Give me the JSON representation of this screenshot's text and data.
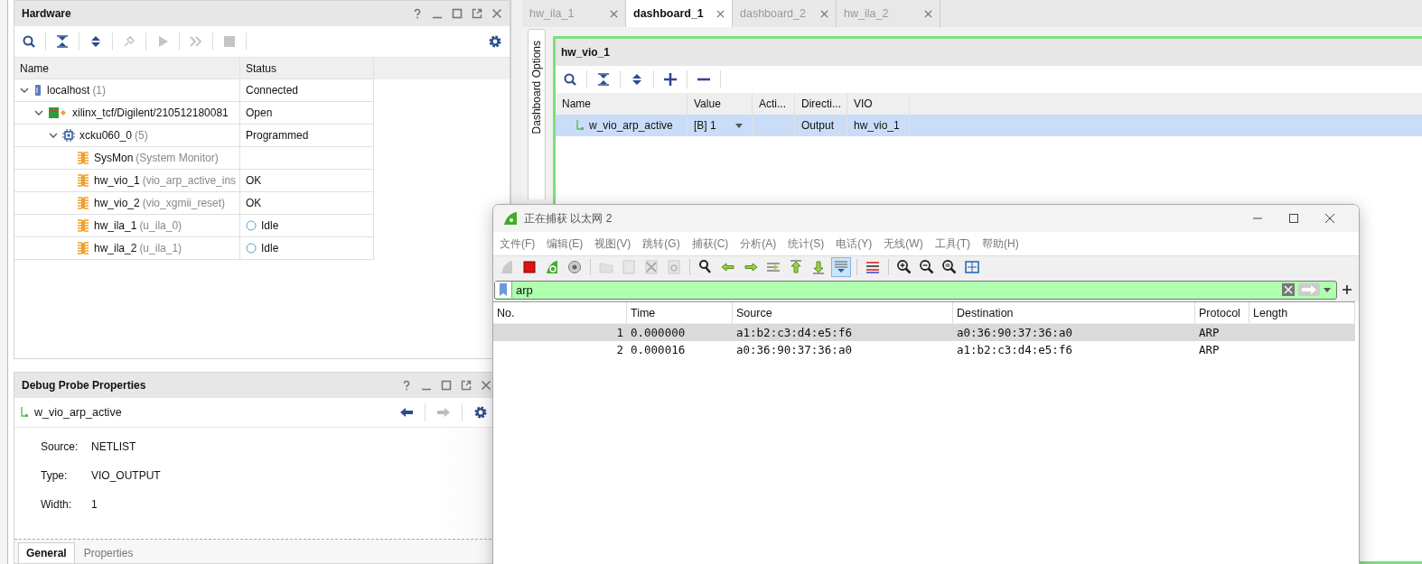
{
  "hardware": {
    "title": "Hardware",
    "toolbar": [
      {
        "kind": "search",
        "disabled": false
      },
      {
        "kind": "collapse",
        "disabled": false
      },
      {
        "kind": "expand",
        "disabled": false
      },
      {
        "kind": "connect",
        "disabled": true
      },
      {
        "kind": "run",
        "disabled": true
      },
      {
        "kind": "run-all",
        "disabled": true
      },
      {
        "kind": "stop",
        "disabled": true
      }
    ],
    "columns": [
      "Name",
      "Status"
    ],
    "tree": [
      {
        "kind": "host",
        "name": "localhost",
        "detail": "(1)",
        "status": "Connected",
        "idle": false,
        "expanded": true,
        "children": [
          {
            "kind": "target",
            "name": "xilinx_tcf/Digilent/210512180081",
            "status": "Open",
            "idle": false,
            "expanded": true,
            "children": [
              {
                "kind": "device",
                "name": "xcku060_0",
                "detail": "(5)",
                "status": "Programmed",
                "idle": false,
                "expanded": true,
                "children": [
                  {
                    "kind": "core",
                    "name": "SysMon",
                    "detail": "(System Monitor)",
                    "idle": false
                  },
                  {
                    "kind": "core",
                    "name": "hw_vio_1",
                    "detail": "(vio_arp_active_ins",
                    "status": "OK",
                    "idle": false
                  },
                  {
                    "kind": "core",
                    "name": "hw_vio_2",
                    "detail": "(vio_xgmii_reset)",
                    "status": "OK",
                    "idle": false
                  },
                  {
                    "kind": "core",
                    "name": "hw_ila_1",
                    "detail": "(u_ila_0)",
                    "status": "Idle",
                    "idle": true
                  },
                  {
                    "kind": "core",
                    "name": "hw_ila_2",
                    "detail": "(u_ila_1)",
                    "status": "Idle",
                    "idle": true
                  }
                ]
              }
            ]
          }
        ]
      }
    ]
  },
  "probe_properties": {
    "title": "Debug Probe Properties",
    "probe": "w_vio_arp_active",
    "back_disabled": false,
    "forward_disabled": true,
    "fields": [
      {
        "label": "Source:",
        "value": "NETLIST"
      },
      {
        "label": "Type:",
        "value": "VIO_OUTPUT"
      },
      {
        "label": "Width:",
        "value": "1"
      }
    ],
    "tabs": [
      {
        "label": "General",
        "selected": true
      },
      {
        "label": "Properties",
        "selected": false
      }
    ]
  },
  "editor_tabs": [
    {
      "label": "hw_ila_1",
      "selected": false
    },
    {
      "label": "dashboard_1",
      "selected": true
    },
    {
      "label": "dashboard_2",
      "selected": false
    },
    {
      "label": "hw_ila_2",
      "selected": false
    }
  ],
  "dashboard": {
    "side_tab": "Dashboard Options",
    "title": "hw_vio_1",
    "columns": [
      "Name",
      "Value",
      "Acti...",
      "Directi...",
      "VIO"
    ],
    "rows": [
      {
        "name": "w_vio_arp_active",
        "value": "[B] 1",
        "direction": "Output",
        "vio": "hw_vio_1",
        "selected": true
      }
    ]
  },
  "capture_window": {
    "title": "正在捕获 以太网 2",
    "menu": [
      "文件(F)",
      "编辑(E)",
      "视图(V)",
      "跳转(G)",
      "捕获(C)",
      "分析(A)",
      "统计(S)",
      "电话(Y)",
      "无线(W)",
      "工具(T)",
      "帮助(H)"
    ],
    "toolbar": [
      [
        {
          "kind": "fin",
          "disabled": true,
          "active": false
        },
        {
          "kind": "stop",
          "disabled": false,
          "active": false
        },
        {
          "kind": "restart",
          "disabled": false,
          "active": false
        },
        {
          "kind": "options",
          "disabled": false,
          "active": false
        }
      ],
      [
        {
          "kind": "folder",
          "disabled": true,
          "active": false
        },
        {
          "kind": "file",
          "disabled": true,
          "active": false
        },
        {
          "kind": "close",
          "disabled": true,
          "active": false
        },
        {
          "kind": "reload",
          "disabled": true,
          "active": false
        }
      ],
      [
        {
          "kind": "find",
          "disabled": false,
          "active": false
        },
        {
          "kind": "back",
          "disabled": false,
          "active": false
        },
        {
          "kind": "forward",
          "disabled": false,
          "active": false
        },
        {
          "kind": "goto",
          "disabled": false,
          "active": false
        },
        {
          "kind": "first",
          "disabled": false,
          "active": false
        },
        {
          "kind": "last",
          "disabled": false,
          "active": false
        },
        {
          "kind": "autoscroll",
          "disabled": false,
          "active": true
        }
      ],
      [
        {
          "kind": "colorize",
          "disabled": false,
          "active": false
        }
      ],
      [
        {
          "kind": "zoom-in",
          "disabled": false,
          "active": false
        },
        {
          "kind": "zoom-out",
          "disabled": false,
          "active": false
        },
        {
          "kind": "zoom-reset",
          "disabled": false,
          "active": false
        },
        {
          "kind": "resize",
          "disabled": false,
          "active": false
        }
      ]
    ],
    "filter": {
      "value": "arp"
    },
    "columns": [
      "No.",
      "Time",
      "Source",
      "Destination",
      "Protocol",
      "Length"
    ],
    "packets": [
      {
        "no": "1",
        "time": "0.000000",
        "source": "a1:b2:c3:d4:e5:f6",
        "destination": "a0:36:90:37:36:a0",
        "protocol": "ARP",
        "selected": true
      },
      {
        "no": "2",
        "time": "0.000016",
        "source": "a0:36:90:37:36:a0",
        "destination": "a1:b2:c3:d4:e5:f6",
        "protocol": "ARP",
        "selected": false
      }
    ]
  }
}
